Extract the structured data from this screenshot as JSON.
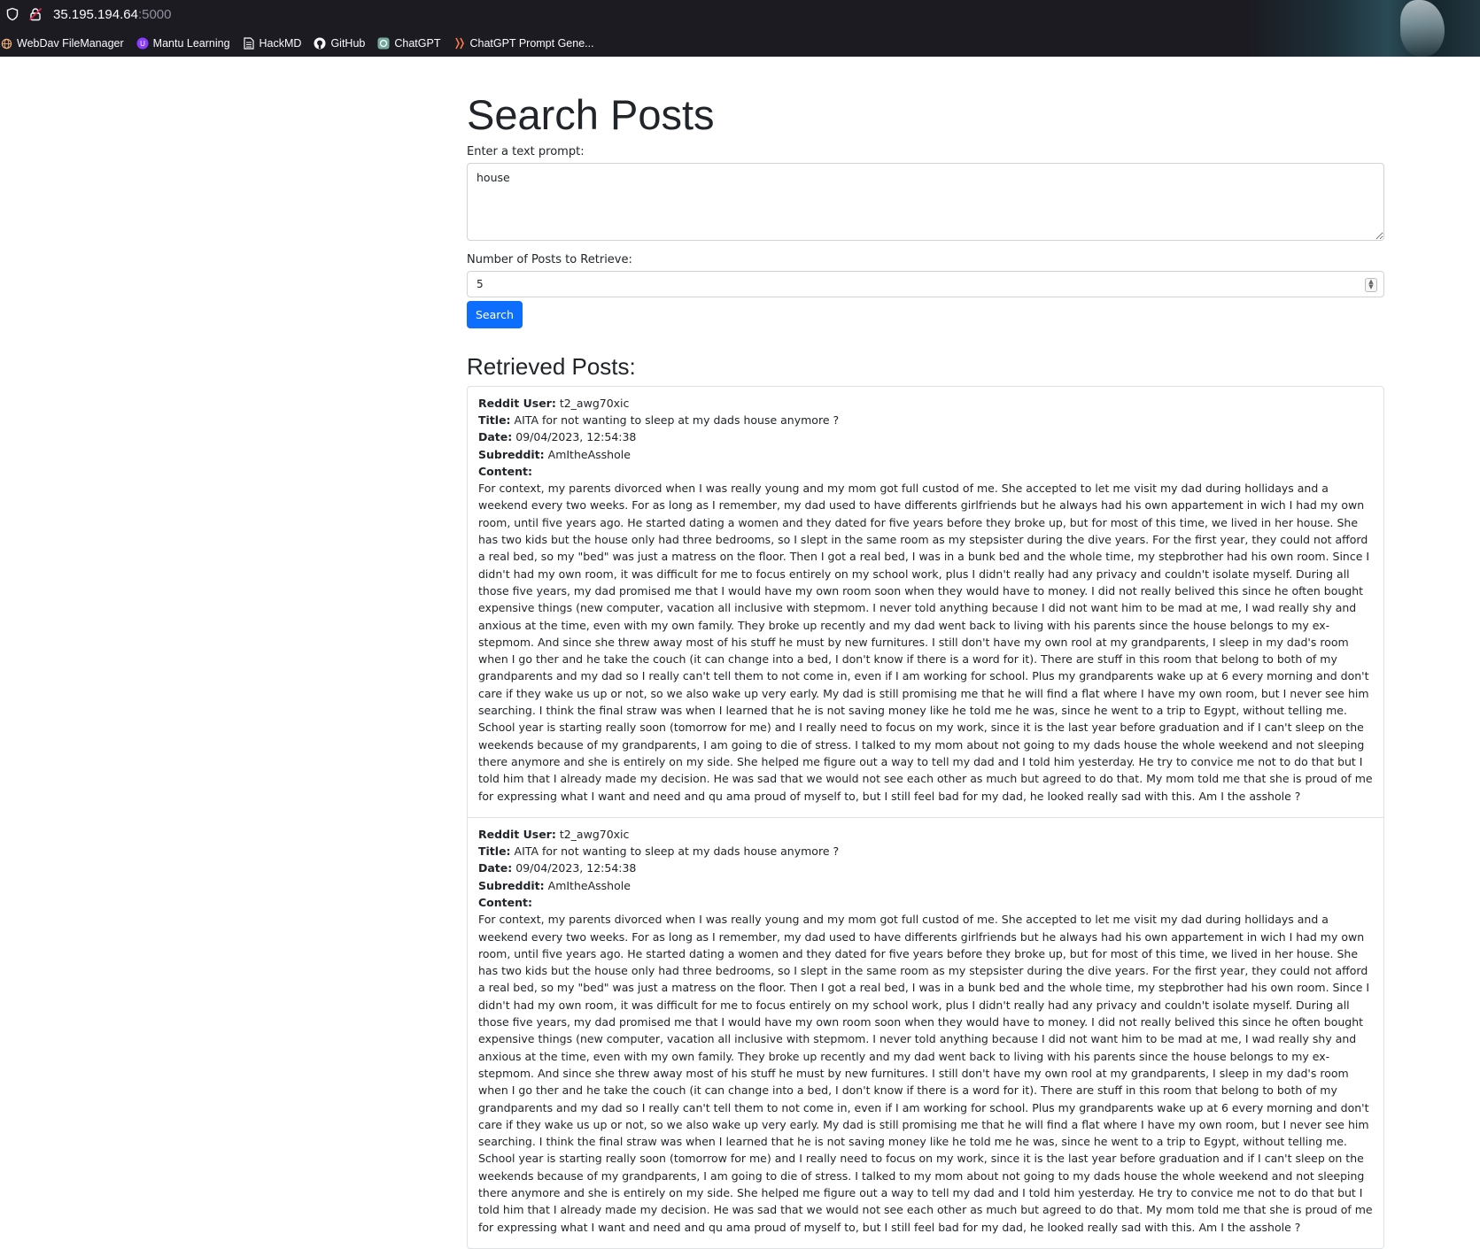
{
  "browser": {
    "url_host": "35.195.194.64",
    "url_port": ":5000",
    "bookmarks": [
      {
        "label": "WebDav FileManager",
        "icon": "globe-icon"
      },
      {
        "label": "Mantu Learning",
        "icon": "mantu-icon"
      },
      {
        "label": "HackMD",
        "icon": "document-icon"
      },
      {
        "label": "GitHub",
        "icon": "github-icon"
      },
      {
        "label": "ChatGPT",
        "icon": "chatgpt-icon"
      },
      {
        "label": "ChatGPT Prompt Gene...",
        "icon": "prompt-generator-icon"
      }
    ]
  },
  "page": {
    "title": "Search Posts",
    "prompt_label": "Enter a text prompt:",
    "prompt_value": "house",
    "count_label": "Number of Posts to Retrieve:",
    "count_value": "5",
    "search_button": "Search",
    "results_title": "Retrieved Posts:"
  },
  "field_labels": {
    "user": "Reddit User:",
    "title": "Title:",
    "date": "Date:",
    "subreddit": "Subreddit:",
    "content": "Content:"
  },
  "posts": [
    {
      "user": "t2_awg70xic",
      "title": "AITA for not wanting to sleep at my dads house anymore ?",
      "date": "09/04/2023, 12:54:38",
      "subreddit": "AmItheAsshole",
      "content": "For context, my parents divorced when I was really young and my mom got full custod of me. She accepted to let me visit my dad during hollidays and a weekend every two weeks. For as long as I remember, my dad used to have differents girlfriends but he always had his own appartement in wich I had my own room, until five years ago. He started dating a women and they dated for five years before they broke up, but for most of this time, we lived in her house. She has two kids but the house only had three bedrooms, so I slept in the same room as my stepsister during the dive years. For the first year, they could not afford a real bed, so my \"bed\" was just a matress on the floor. Then I got a real bed, I was in a bunk bed and the whole time, my stepbrother had his own room. Since I didn't had my own room, it was difficult for me to focus entirely on my school work, plus I didn't really had any privacy and couldn't isolate myself. During all those five years, my dad promised me that I would have my own room soon when they would have to money. I did not really belived this since he often bought expensive things (new computer, vacation all inclusive with stepmom. I never told anything because I did not want him to be mad at me, I wad really shy and anxious at the time, even with my own family. They broke up recently and my dad went back to living with his parents since the house belongs to my ex-stepmom. And since she threw away most of his stuff he must by new furnitures. I still don't have my own rool at my grandparents, I sleep in my dad's room when I go ther and he take the couch (it can change into a bed, I don't know if there is a word for it). There are stuff in this room that belong to both of my grandparents and my dad so I really can't tell them to not come in, even if I am working for school. Plus my grandparents wake up at 6 every morning and don't care if they wake us up or not, so we also wake up very early. My dad is still promising me that he will find a flat where I have my own room, but I never see him searching. I think the final straw was when I learned that he is not saving money like he told me he was, since he went to a trip to Egypt, without telling me. School year is starting really soon (tomorrow for me) and I really need to focus on my work, since it is the last year before graduation and if I can't sleep on the weekends because of my grandparents, I am going to die of stress. I talked to my mom about not going to my dads house the whole weekend and not sleeping there anymore and she is entirely on my side. She helped me figure out a way to tell my dad and I told him yesterday. He try to convice me not to do that but I told him that I already made my decision. He was sad that we would not see each other as much but agreed to do that. My mom told me that she is proud of me for expressing what I want and need and qu ama proud of myself to, but I still feel bad for my dad, he looked really sad with this. Am I the asshole ?"
    },
    {
      "user": "t2_awg70xic",
      "title": "AITA for not wanting to sleep at my dads house anymore ?",
      "date": "09/04/2023, 12:54:38",
      "subreddit": "AmItheAsshole",
      "content": "For context, my parents divorced when I was really young and my mom got full custod of me. She accepted to let me visit my dad during hollidays and a weekend every two weeks. For as long as I remember, my dad used to have differents girlfriends but he always had his own appartement in wich I had my own room, until five years ago. He started dating a women and they dated for five years before they broke up, but for most of this time, we lived in her house. She has two kids but the house only had three bedrooms, so I slept in the same room as my stepsister during the dive years. For the first year, they could not afford a real bed, so my \"bed\" was just a matress on the floor. Then I got a real bed, I was in a bunk bed and the whole time, my stepbrother had his own room. Since I didn't had my own room, it was difficult for me to focus entirely on my school work, plus I didn't really had any privacy and couldn't isolate myself. During all those five years, my dad promised me that I would have my own room soon when they would have to money. I did not really belived this since he often bought expensive things (new computer, vacation all inclusive with stepmom. I never told anything because I did not want him to be mad at me, I wad really shy and anxious at the time, even with my own family. They broke up recently and my dad went back to living with his parents since the house belongs to my ex-stepmom. And since she threw away most of his stuff he must by new furnitures. I still don't have my own rool at my grandparents, I sleep in my dad's room when I go ther and he take the couch (it can change into a bed, I don't know if there is a word for it). There are stuff in this room that belong to both of my grandparents and my dad so I really can't tell them to not come in, even if I am working for school. Plus my grandparents wake up at 6 every morning and don't care if they wake us up or not, so we also wake up very early. My dad is still promising me that he will find a flat where I have my own room, but I never see him searching. I think the final straw was when I learned that he is not saving money like he told me he was, since he went to a trip to Egypt, without telling me. School year is starting really soon (tomorrow for me) and I really need to focus on my work, since it is the last year before graduation and if I can't sleep on the weekends because of my grandparents, I am going to die of stress. I talked to my mom about not going to my dads house the whole weekend and not sleeping there anymore and she is entirely on my side. She helped me figure out a way to tell my dad and I told him yesterday. He try to convice me not to do that but I told him that I already made my decision. He was sad that we would not see each other as much but agreed to do that. My mom told me that she is proud of me for expressing what I want and need and qu ama proud of myself to, but I still feel bad for my dad, he looked really sad with this. Am I the asshole ?"
    }
  ]
}
